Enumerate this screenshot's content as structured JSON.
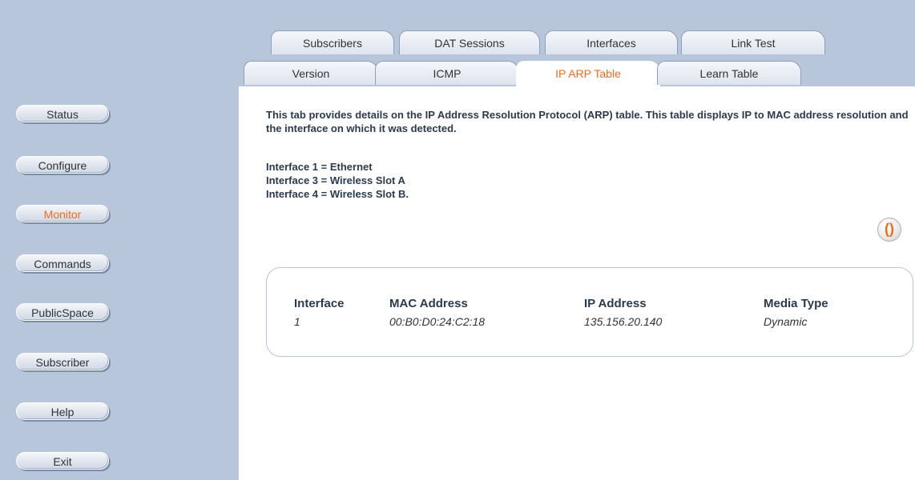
{
  "sidebar": {
    "items": [
      {
        "label": "Status"
      },
      {
        "label": "Configure"
      },
      {
        "label": "Monitor",
        "active": true
      },
      {
        "label": "Commands"
      },
      {
        "label": "PublicSpace"
      },
      {
        "label": "Subscriber"
      },
      {
        "label": "Help"
      },
      {
        "label": "Exit"
      }
    ]
  },
  "tabs_top": [
    {
      "label": "Subscribers"
    },
    {
      "label": "DAT Sessions"
    },
    {
      "label": "Interfaces"
    },
    {
      "label": "Link Test"
    }
  ],
  "tabs_bottom": [
    {
      "label": "Version"
    },
    {
      "label": "ICMP"
    },
    {
      "label": "IP ARP Table",
      "active": true
    },
    {
      "label": "Learn Table"
    }
  ],
  "main": {
    "description": "This tab provides details on the IP Address Resolution Protocol (ARP) table. This table displays IP to MAC address resolution and the interface on which it was detected.",
    "interface_notes": [
      "Interface 1 = Ethernet",
      "Interface 3 = Wireless Slot A",
      "Interface 4 = Wireless Slot B."
    ],
    "refresh_icon": "refresh-icon",
    "table": {
      "headers": [
        "Interface",
        "MAC Address",
        "IP Address",
        "Media Type"
      ],
      "rows": [
        [
          "1",
          "00:B0:D0:24:C2:18",
          "135.156.20.140",
          "Dynamic"
        ]
      ]
    }
  },
  "colors": {
    "sidebar_bg": "#b7c6db",
    "accent": "#f26a1b",
    "text": "#2b3a4f"
  }
}
